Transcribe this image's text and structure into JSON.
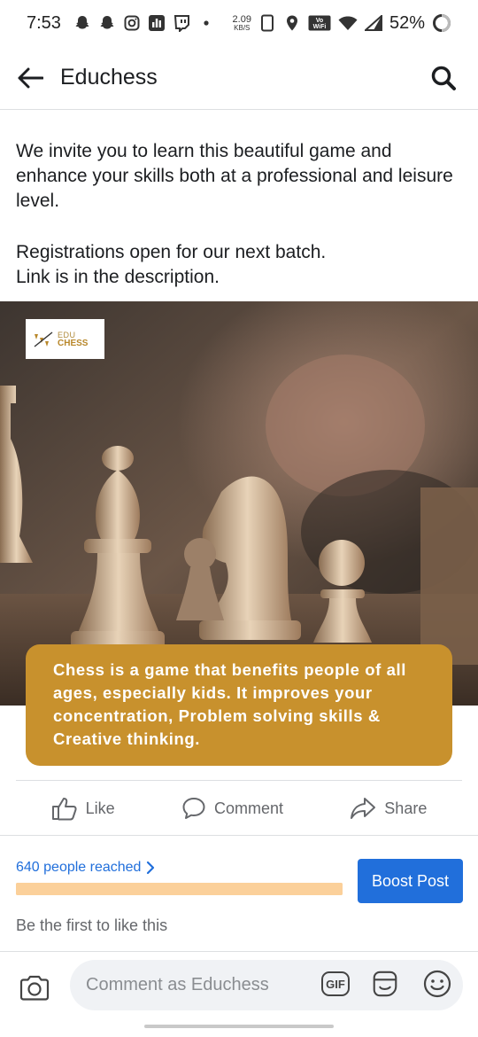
{
  "status_bar": {
    "time": "7:53",
    "speed_value": "2.09",
    "speed_unit": "KB/S",
    "battery_percent": "52%",
    "wifi_label": "Vo WiFi"
  },
  "header": {
    "title": "Educhess"
  },
  "post": {
    "cut_text": "",
    "paragraph_1": "We invite you to learn this beautiful game and enhance your skills both at a professional and leisure level.",
    "paragraph_2_line_1": "Registrations open for our next batch.",
    "paragraph_2_line_2": "Link is in the description."
  },
  "image": {
    "logo_line_1": "EDU",
    "logo_line_2": "CHESS",
    "caption": "Chess is a game that benefits people of all ages, especially kids. It improves your concentration, Problem solving skills & Creative thinking."
  },
  "actions": {
    "like_label": "Like",
    "comment_label": "Comment",
    "share_label": "Share"
  },
  "insights": {
    "reached_label": "640 people reached",
    "boost_label": "Boost Post",
    "progress_fraction": 1.0,
    "first_like_text": "Be the first to like this"
  },
  "comment_bar": {
    "placeholder": "Comment as Educhess",
    "gif_label": "GIF"
  },
  "colors": {
    "accent_blue": "#216fdb",
    "caption_gold": "#c8912d",
    "progress_peach": "#fbd09a",
    "muted_gray": "#65676b"
  },
  "icons": {
    "status": [
      "snapchat-icon",
      "snapchat-icon",
      "instagram-icon",
      "stats-icon",
      "twitch-icon",
      "dot-icon",
      "phone-icon",
      "location-icon",
      "vowifi-icon",
      "wifi-icon",
      "signal-icon",
      "battery-icon"
    ],
    "header": [
      "back-arrow-icon",
      "search-icon"
    ],
    "actions": [
      "thumbs-up-icon",
      "comment-bubble-icon",
      "share-arrow-icon"
    ],
    "comment": [
      "camera-icon",
      "gif-icon",
      "sticker-icon",
      "emoji-icon"
    ]
  }
}
